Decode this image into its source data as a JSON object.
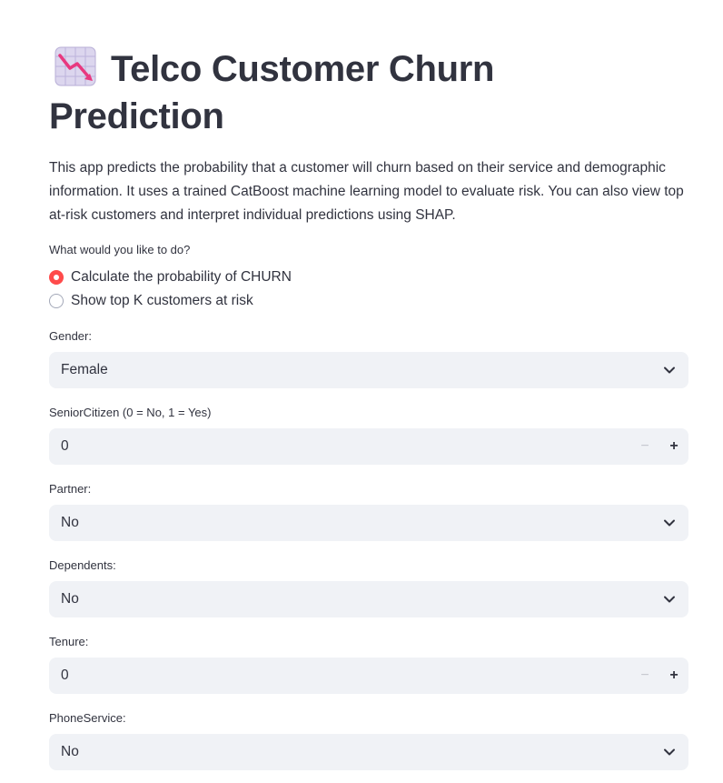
{
  "header": {
    "title": "Telco Customer Churn Prediction",
    "icon": "chart-decreasing-icon"
  },
  "description": "This app predicts the probability that a customer will churn based on their service and demographic information. It uses a trained CatBoost machine learning model to evaluate risk. You can also view top at-risk customers and interpret individual predictions using SHAP.",
  "mode": {
    "label": "What would you like to do?",
    "options": [
      {
        "label": "Calculate the probability of CHURN",
        "selected": true
      },
      {
        "label": "Show top K customers at risk",
        "selected": false
      }
    ]
  },
  "form": {
    "gender": {
      "label": "Gender:",
      "value": "Female"
    },
    "senior_citizen": {
      "label": "SeniorCitizen (0 = No, 1 = Yes)",
      "value": "0",
      "minus": "−",
      "plus": "+"
    },
    "partner": {
      "label": "Partner:",
      "value": "No"
    },
    "dependents": {
      "label": "Dependents:",
      "value": "No"
    },
    "tenure": {
      "label": "Tenure:",
      "value": "0",
      "minus": "−",
      "plus": "+"
    },
    "phone_service": {
      "label": "PhoneService:",
      "value": "No"
    }
  },
  "colors": {
    "accent": "#ff4b4b",
    "text": "#31333f",
    "field_bg": "#f0f2f6"
  }
}
